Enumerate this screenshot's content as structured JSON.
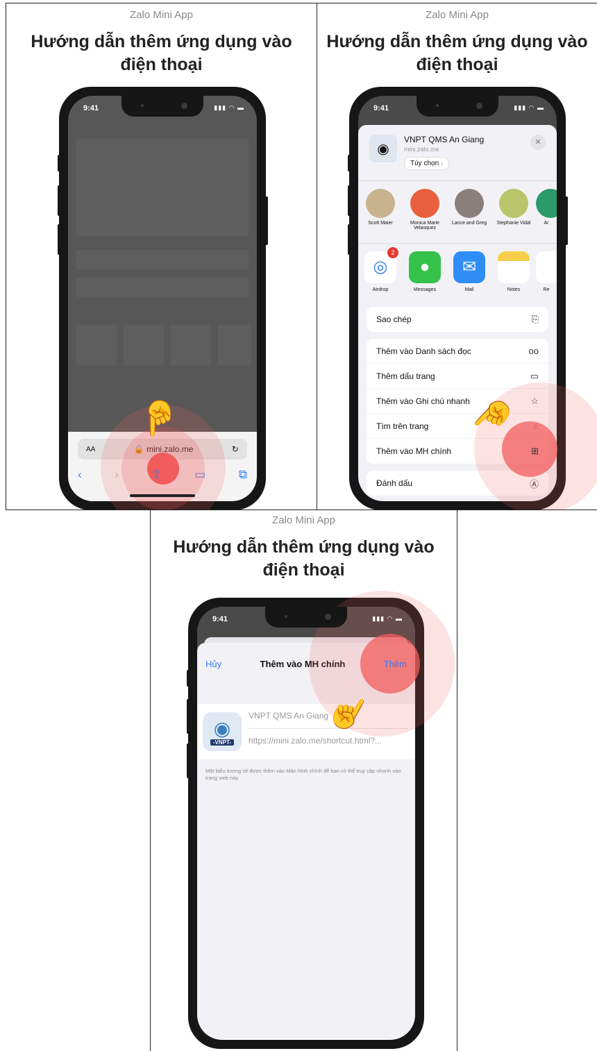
{
  "caption": "Zalo Mini App",
  "heading": "Hướng dẫn thêm ứng dụng vào điện thoại",
  "status_time": "9:41",
  "panel1": {
    "url": "mini.zalo.me",
    "aa": "AA"
  },
  "panel2": {
    "app_name": "VNPT QMS An Giang",
    "app_url": "mini.zalo.me",
    "options_label": "Tùy chọn",
    "contacts": [
      "Scott Maier",
      "Monica Marie Velasquez",
      "Lance and Greg",
      "Stephanie Vidal",
      "Ar"
    ],
    "apps": [
      {
        "label": "Airdrop",
        "badge": "2"
      },
      {
        "label": "Messages"
      },
      {
        "label": "Mail"
      },
      {
        "label": "Notes"
      },
      {
        "label": "Re"
      }
    ],
    "actions": {
      "copy": "Sao chép",
      "reading_list": "Thêm vào Danh sách đọc",
      "bookmark": "Thêm dấu trang",
      "quick_note": "Thêm vào Ghi chú nhanh",
      "find": "Tìm trên trang",
      "add_home": "Thêm vào MH chính",
      "markup": "Đánh dấu"
    }
  },
  "panel3": {
    "cancel": "Hủy",
    "title": "Thêm vào MH chính",
    "add": "Thêm",
    "name_value": "VNPT QMS An Giang",
    "url_value": "https://mini.zalo.me/shortcut.html?...",
    "description": "Một biểu tượng sẽ được thêm vào Màn hình chính để bạn có thể truy cập nhanh vào trang web này.",
    "logo_text": "-VNPT-"
  },
  "colors": {
    "accent": "#2f7df6",
    "highlight": "#f25c5c",
    "sheet_bg": "#f2f2f6"
  }
}
